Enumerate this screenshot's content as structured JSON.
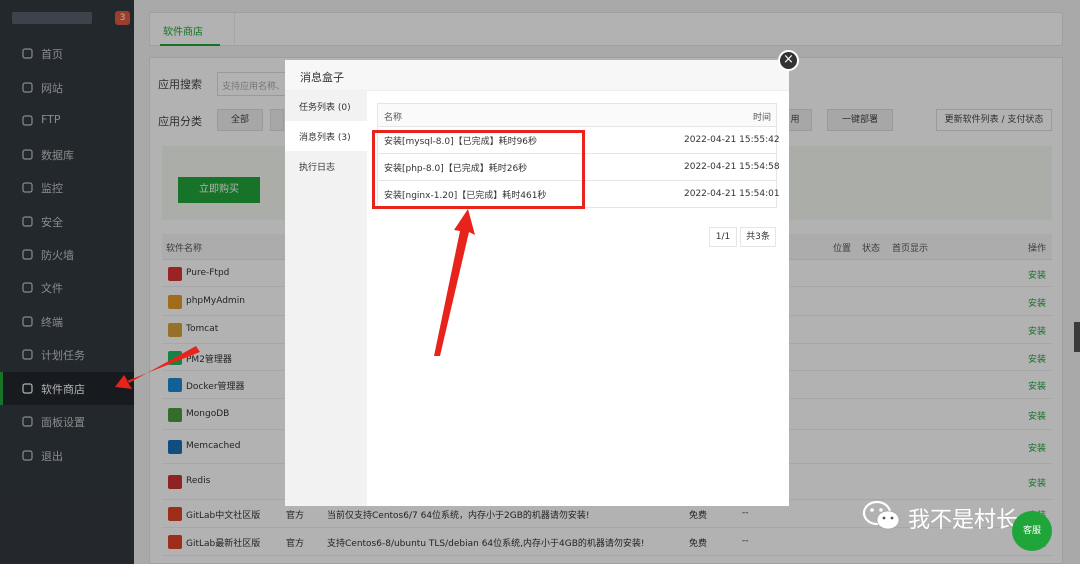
{
  "sidebar": {
    "badge": "3",
    "items": [
      {
        "label": "首页",
        "icon": "home-icon"
      },
      {
        "label": "网站",
        "icon": "globe-icon"
      },
      {
        "label": "FTP",
        "icon": "ftp-icon"
      },
      {
        "label": "数据库",
        "icon": "database-icon"
      },
      {
        "label": "监控",
        "icon": "monitor-icon"
      },
      {
        "label": "安全",
        "icon": "shield-icon"
      },
      {
        "label": "防火墙",
        "icon": "firewall-icon"
      },
      {
        "label": "文件",
        "icon": "folder-icon"
      },
      {
        "label": "终端",
        "icon": "terminal-icon"
      },
      {
        "label": "计划任务",
        "icon": "clock-icon"
      },
      {
        "label": "软件商店",
        "icon": "apps-icon"
      },
      {
        "label": "面板设置",
        "icon": "gear-icon"
      },
      {
        "label": "退出",
        "icon": "logout-icon"
      }
    ],
    "active_index": 10
  },
  "header": {
    "tab": "软件商店"
  },
  "store": {
    "search_label": "应用搜索",
    "search_placeholder": "支持应用名称、",
    "category_label": "应用分类",
    "category_all": "全部",
    "cat_partial": "用",
    "one_click": "一键部署",
    "update_list": "更新软件列表 / 支付状态",
    "buy_label": "立即购买",
    "columns": {
      "name": "软件名称",
      "location": "位置",
      "status": "状态",
      "home": "首页显示",
      "action": "操作"
    },
    "rows": [
      {
        "name": "Pure-Ftpd",
        "icon": "ftp-logo-icon",
        "action": "安装"
      },
      {
        "name": "phpMyAdmin",
        "icon": "phpmyadmin-icon",
        "action": "安装"
      },
      {
        "name": "Tomcat",
        "icon": "tomcat-icon",
        "action": "安装"
      },
      {
        "name": "PM2管理器",
        "icon": "pm2-icon",
        "action": "安装"
      },
      {
        "name": "Docker管理器",
        "icon": "docker-icon",
        "action": "安装"
      },
      {
        "name": "MongoDB",
        "icon": "mongodb-icon",
        "action": "安装"
      },
      {
        "name": "Memcached",
        "icon": "memcached-icon",
        "action": "安装"
      },
      {
        "name": "Redis",
        "icon": "redis-icon",
        "action": "安装"
      },
      {
        "name": "GitLab中文社区版",
        "icon": "gitlab-icon",
        "dev": "官方",
        "desc": "当前仅支持Centos6/7 64位系统，内存小于2GB的机器请勿安装!",
        "price": "免费",
        "exp": "--",
        "action": "安装"
      },
      {
        "name": "GitLab最新社区版",
        "icon": "gitlab-icon",
        "dev": "官方",
        "desc": "支持Centos6-8/ubuntu TLS/debian 64位系统,内存小于4GB的机器请勿安装!",
        "price": "免费",
        "exp": "--",
        "action": "安装"
      }
    ]
  },
  "modal": {
    "title": "消息盒子",
    "tabs": [
      "任务列表 (0)",
      "消息列表 (3)",
      "执行日志"
    ],
    "active_tab": 1,
    "col_name": "名称",
    "col_time": "时间",
    "messages": [
      {
        "title": "安装[mysql-8.0]【已完成】耗时96秒",
        "time": "2022-04-21 15:55:42"
      },
      {
        "title": "安装[php-8.0]【已完成】耗时26秒",
        "time": "2022-04-21 15:54:58"
      },
      {
        "title": "安装[nginx-1.20]【已完成】耗时461秒",
        "time": "2022-04-21 15:54:01"
      }
    ],
    "page": "1/1",
    "total": "共3条",
    "close": "×"
  },
  "watermark": {
    "text": "我不是村长"
  },
  "kefu": {
    "label": "客服"
  },
  "colors": {
    "accent": "#20a53a",
    "annotation": "#e8231b",
    "sidebar": "#333a40"
  }
}
